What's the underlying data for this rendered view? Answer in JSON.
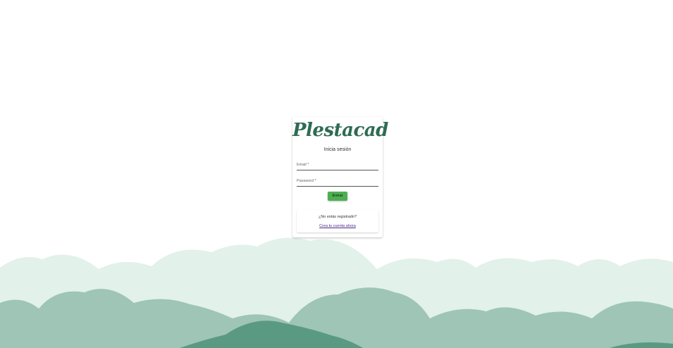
{
  "brand": {
    "logo_text": "Plestacad",
    "color": "#2f6b53"
  },
  "login": {
    "subtitle": "Inicia sesión",
    "email_label": "Email *",
    "password_label": "Password *",
    "submit_label": "Entrar",
    "submit_color": "#4caf50"
  },
  "register": {
    "question": "¿No estás registrado?",
    "link_label": "Crea tu cuenta ahora",
    "link_color": "#4b2a8a"
  },
  "background": {
    "hill_colors": [
      "#e2f1e9",
      "#9ec5b6",
      "#5b9a82"
    ]
  }
}
